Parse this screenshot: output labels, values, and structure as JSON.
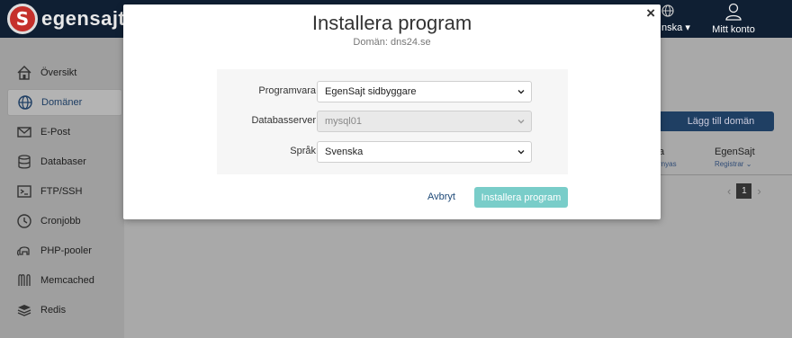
{
  "topbar": {
    "logo_mark": "S",
    "logo_text": "egensajt",
    "language": "nska",
    "account_label": "Mitt konto"
  },
  "sidebar": {
    "items": [
      {
        "label": "Översikt",
        "icon": "home-icon"
      },
      {
        "label": "Domäner",
        "icon": "globe-icon",
        "active": true
      },
      {
        "label": "E-Post",
        "icon": "envelope-icon"
      },
      {
        "label": "Databaser",
        "icon": "database-icon"
      },
      {
        "label": "FTP/SSH",
        "icon": "terminal-icon"
      },
      {
        "label": "Cronjobb",
        "icon": "clock-icon"
      },
      {
        "label": "PHP-pooler",
        "icon": "elephant-icon"
      },
      {
        "label": "Memcached",
        "icon": "memcached-icon"
      },
      {
        "label": "Redis",
        "icon": "redis-icon"
      }
    ]
  },
  "content": {
    "add_domain_button": "Lägg till domän",
    "column_left_head": "a",
    "column_left_sub": "rnyas",
    "column_head": "EgenSajt",
    "column_sub": "Registrar",
    "page": "1"
  },
  "modal": {
    "title": "Installera program",
    "subtitle": "Domän: dns24.se",
    "close_label": "×",
    "fields": {
      "software": {
        "label": "Programvara",
        "value": "EgenSajt sidbyggare"
      },
      "database_server": {
        "label": "Databasserver",
        "value": "mysql01",
        "disabled": true
      },
      "language": {
        "label": "Språk",
        "value": "Svenska"
      }
    },
    "cancel_label": "Avbryt",
    "install_label": "Installera program"
  },
  "colors": {
    "topbar": "#0f1f33",
    "overlay": "#a9a9a9",
    "install_button": "#79cdc9",
    "primary_button": "#1f3f63",
    "link": "#1f4a78"
  }
}
